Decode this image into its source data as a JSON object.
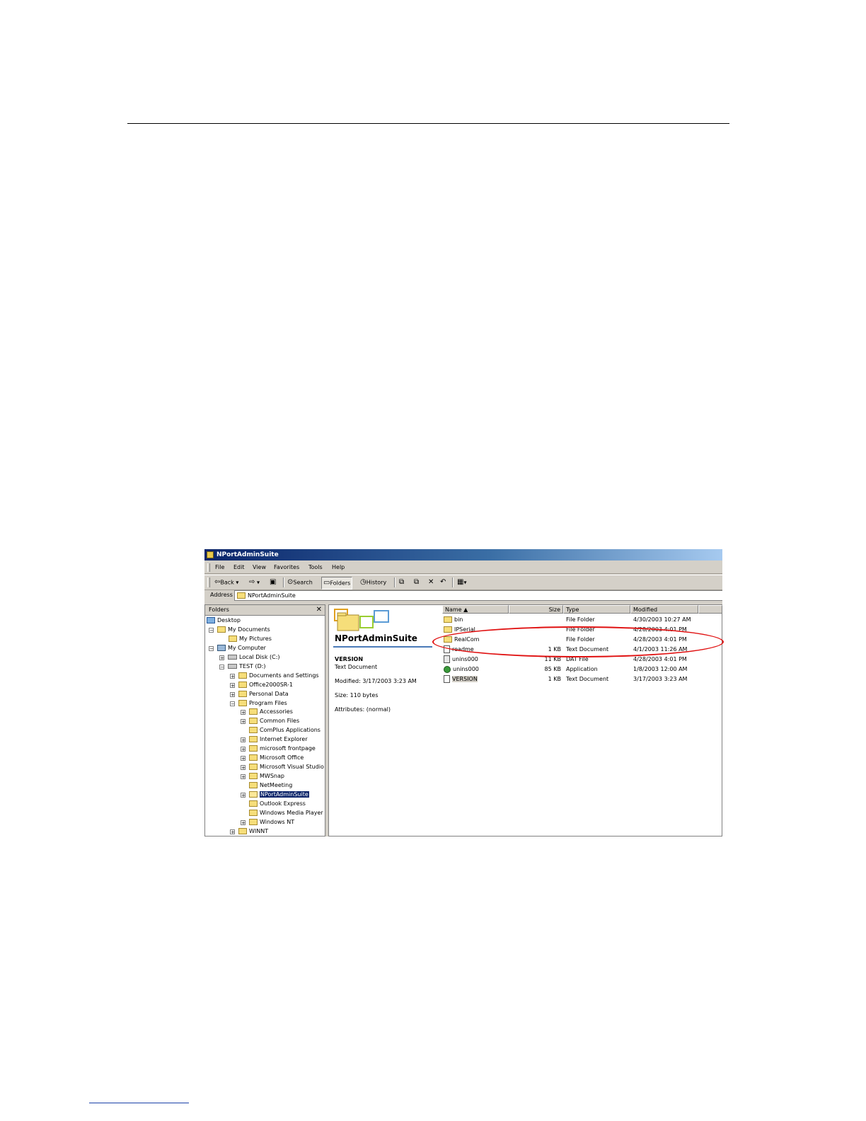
{
  "window": {
    "title": "NPortAdminSuite"
  },
  "menu": [
    "File",
    "Edit",
    "View",
    "Favorites",
    "Tools",
    "Help"
  ],
  "toolbar": {
    "back": "Back",
    "search": "Search",
    "folders": "Folders",
    "history": "History"
  },
  "address": {
    "label": "Address",
    "value": "NPortAdminSuite"
  },
  "folders_pane": {
    "title": "Folders",
    "tree": [
      "Desktop",
      "My Documents",
      "My Pictures",
      "My Computer",
      "Local Disk (C:)",
      "TEST (D:)",
      "Documents and Settings",
      "Office2000SR-1",
      "Personal Data",
      "Program Files",
      "Accessories",
      "Common Files",
      "ComPlus Applications",
      "Internet Explorer",
      "microsoft frontpage",
      "Microsoft Office",
      "Microsoft Visual Studio",
      "MWSnap",
      "NetMeeting",
      "NPortAdminSuite",
      "Outlook Express",
      "Windows Media Player",
      "Windows NT",
      "WINNT"
    ]
  },
  "web_panel": {
    "folder_title": "NPortAdminSuite",
    "selected_name": "VERSION",
    "selected_type": "Text Document",
    "modified": "Modified: 3/17/2003 3:23 AM",
    "size": "Size: 110 bytes",
    "attributes": "Attributes: (normal)"
  },
  "file_list": {
    "columns": [
      "Name",
      "Size",
      "Type",
      "Modified"
    ],
    "rows": [
      {
        "name": "bin",
        "size": "",
        "type": "File Folder",
        "modified": "4/30/2003 10:27 AM",
        "icon": "folder-icon"
      },
      {
        "name": "IPSerial",
        "size": "",
        "type": "File Folder",
        "modified": "4/28/2003 4:01 PM",
        "icon": "folder-icon"
      },
      {
        "name": "RealCom",
        "size": "",
        "type": "File Folder",
        "modified": "4/28/2003 4:01 PM",
        "icon": "folder-icon"
      },
      {
        "name": "readme",
        "size": "1 KB",
        "type": "Text Document",
        "modified": "4/1/2003 11:26 AM",
        "icon": "text-document-icon"
      },
      {
        "name": "unins000",
        "size": "11 KB",
        "type": "DAT File",
        "modified": "4/28/2003 4:01 PM",
        "icon": "dat-file-icon"
      },
      {
        "name": "unins000",
        "size": "85 KB",
        "type": "Application",
        "modified": "1/8/2003 12:00 AM",
        "icon": "application-icon"
      },
      {
        "name": "VERSION",
        "size": "1 KB",
        "type": "Text Document",
        "modified": "3/17/2003 3:23 AM",
        "icon": "text-document-icon"
      }
    ]
  },
  "colors": {
    "annotation_ellipse": "#e01010",
    "titlebar": "#0a246a",
    "selection": "#0a246a"
  }
}
